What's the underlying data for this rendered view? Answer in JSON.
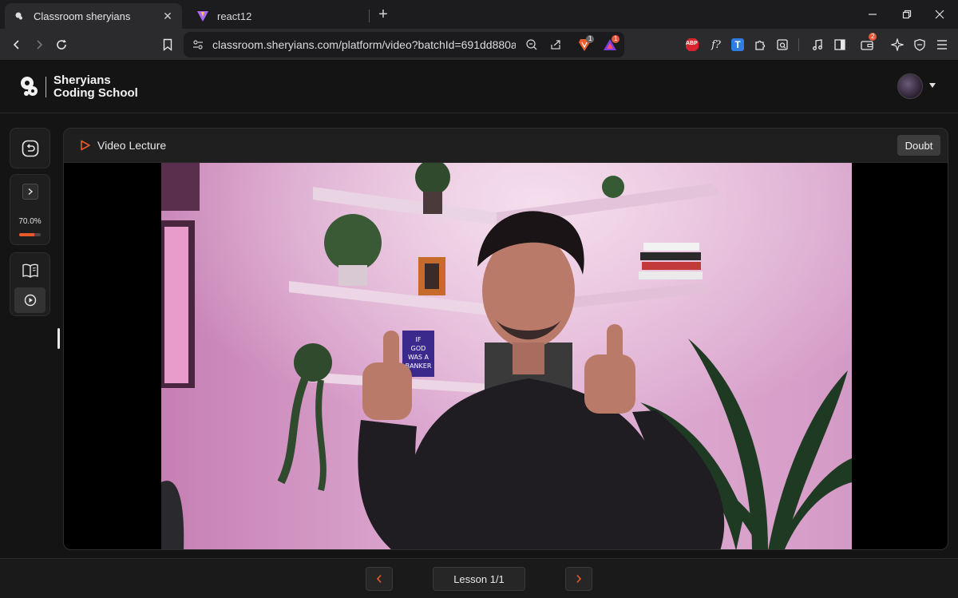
{
  "browser": {
    "tabs": [
      {
        "title": "Classroom sheryians",
        "active": true
      },
      {
        "title": "react12",
        "active": false
      }
    ],
    "url": "classroom.sheryians.com/platform/video?batchId=691dd880a4...",
    "extension_badges": {
      "brave_shield": "1",
      "rewards": "1",
      "wallet": "2"
    },
    "extension_labels": {
      "abp": "ABP",
      "fx": "f?",
      "translate": "T"
    }
  },
  "header": {
    "brand_line1": "Sheryians",
    "brand_line2": "Coding School"
  },
  "sidebar": {
    "progress_text": "70.0%",
    "progress_value": 0.7
  },
  "panel": {
    "title": "Video Lecture",
    "doubt_label": "Doubt"
  },
  "video": {
    "book_lines": [
      "IF",
      "GOD",
      "WAS A",
      "BANKER"
    ]
  },
  "footer": {
    "lesson_label": "Lesson 1/1"
  },
  "colors": {
    "accent": "#e85a2a",
    "background": "#141414"
  }
}
